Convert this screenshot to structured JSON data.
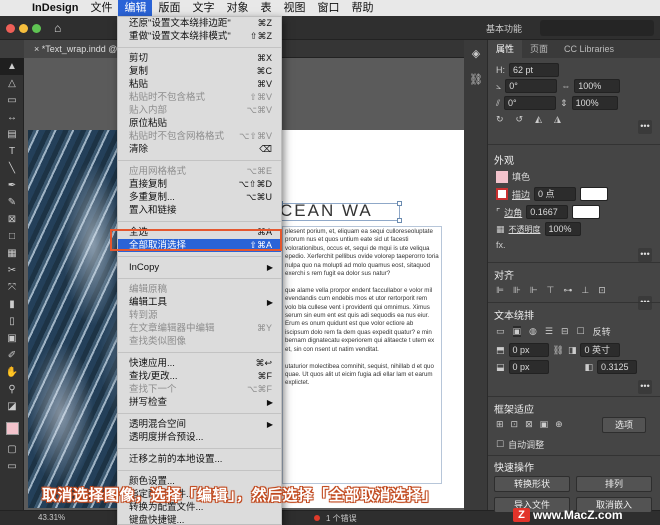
{
  "menubar": {
    "apple_icon": "apple-icon",
    "items": [
      "InDesign",
      "文件",
      "编辑",
      "版面",
      "文字",
      "对象",
      "表",
      "视图",
      "窗口",
      "帮助"
    ]
  },
  "appbar": {
    "workspace": "基本功能"
  },
  "document": {
    "tab": "*Text_wrap.indd @ 50%",
    "heading": "CEAN WA",
    "body": "plesent porium, et, eliquam ea sequi culloreseoluptate prorum nus et quos untium eate sid ut facesti volorationibus, occus et, sequi de mqui is ute veliqua epedio. Xerferchit pellibus ovide volorep taeperorro toria nulpa quo na molupti ad molo quamus eost, sitaquod exerchi s rem fugit ea dolor sus natur?\n\nque alame vella prorpor endent faccullabor e volor mil evendandis cum endebis mos et utor rertorporit rem volo bla cullese vent i providenti qui omnimus. Ximus serum sin eum ent est quis adi sequodis ea nus eiur. Erum es onum quidunt est que volor ectiore ab iscipsum dolo rem fa dem quas expedit quatur? e min bernam dignatecatu experiorem qui alitaecte t utem ex et, sin con nsent ut natim venditat.\n\nutaturior molectibea comnihit, sequist, nihillab d et quo quae. Ut quos alit ut eicim fugia adi ellar lam et earum explictet."
  },
  "statusbar": {
    "zoom": "43.31%",
    "errors": "1 个错误"
  },
  "edit_menu": [
    {
      "label": "还原\"设置文本绕排边距\"",
      "shortcut": "⌘Z",
      "disabled": false
    },
    {
      "label": "重做\"设置文本绕排模式\"",
      "shortcut": "⇧⌘Z",
      "disabled": false
    },
    {
      "sep": true
    },
    {
      "label": "剪切",
      "shortcut": "⌘X",
      "disabled": false
    },
    {
      "label": "复制",
      "shortcut": "⌘C",
      "disabled": false
    },
    {
      "label": "粘贴",
      "shortcut": "⌘V",
      "disabled": false
    },
    {
      "label": "粘贴时不包含格式",
      "shortcut": "⇧⌘V",
      "disabled": true
    },
    {
      "label": "贴入内部",
      "shortcut": "⌥⌘V",
      "disabled": true
    },
    {
      "label": "原位粘贴",
      "shortcut": "",
      "disabled": false
    },
    {
      "label": "粘贴时不包含网格格式",
      "shortcut": "⌥⇧⌘V",
      "disabled": true
    },
    {
      "label": "清除",
      "shortcut": "⌫",
      "disabled": false
    },
    {
      "sep": true
    },
    {
      "label": "应用网格格式",
      "shortcut": "⌥⌘E",
      "disabled": true
    },
    {
      "label": "直接复制",
      "shortcut": "⌥⇧⌘D",
      "disabled": false
    },
    {
      "label": "多重复制...",
      "shortcut": "⌥⌘U",
      "disabled": false
    },
    {
      "label": "置入和链接",
      "shortcut": "",
      "disabled": false
    },
    {
      "sep": true
    },
    {
      "label": "全选",
      "shortcut": "⌘A",
      "disabled": false
    },
    {
      "label": "全部取消选择",
      "shortcut": "⇧⌘A",
      "disabled": false,
      "highlight": true
    },
    {
      "sep": true
    },
    {
      "label": "InCopy",
      "shortcut": "",
      "submenu": true,
      "disabled": false
    },
    {
      "sep": true
    },
    {
      "label": "编辑原稿",
      "shortcut": "",
      "disabled": true
    },
    {
      "label": "编辑工具",
      "shortcut": "",
      "submenu": true,
      "disabled": false
    },
    {
      "label": "转到源",
      "shortcut": "",
      "disabled": true
    },
    {
      "label": "在文章编辑器中编辑",
      "shortcut": "⌘Y",
      "disabled": true
    },
    {
      "label": "查找类似图像",
      "shortcut": "",
      "disabled": true
    },
    {
      "sep": true
    },
    {
      "label": "快速应用...",
      "shortcut": "⌘↩",
      "disabled": false
    },
    {
      "label": "查找/更改...",
      "shortcut": "⌘F",
      "disabled": false
    },
    {
      "label": "查找下一个",
      "shortcut": "⌥⌘F",
      "disabled": true
    },
    {
      "label": "拼写检查",
      "shortcut": "",
      "submenu": true,
      "disabled": false
    },
    {
      "sep": true
    },
    {
      "label": "透明混合空间",
      "shortcut": "",
      "submenu": true,
      "disabled": false
    },
    {
      "label": "透明度拼合预设...",
      "shortcut": "",
      "disabled": false
    },
    {
      "sep": true
    },
    {
      "label": "迁移之前的本地设置...",
      "shortcut": "",
      "disabled": false
    },
    {
      "sep": true
    },
    {
      "label": "颜色设置...",
      "shortcut": "",
      "disabled": false
    },
    {
      "label": "指定配置文件...",
      "shortcut": "",
      "disabled": false
    },
    {
      "label": "转换为配置文件...",
      "shortcut": "",
      "disabled": false
    },
    {
      "label": "键盘快捷键...",
      "shortcut": "",
      "disabled": false
    },
    {
      "label": "菜单...",
      "shortcut": "",
      "disabled": false
    }
  ],
  "panel": {
    "tabs": [
      "属性",
      "页面",
      "CC Libraries"
    ],
    "transform": {
      "angle1": "0°",
      "angle2": "0°",
      "scale1": "100%",
      "scale2": "100%",
      "top_value": "62 pt"
    },
    "appearance": {
      "title": "外观",
      "fill_label": "填色",
      "stroke_label": "描边",
      "stroke_value": "0 点",
      "corner_label": "边角",
      "corner_value": "0.1667",
      "opacity_label": "不透明度",
      "opacity_value": "100%",
      "fx_label": "fx."
    },
    "align": {
      "title": "对齐"
    },
    "text_wrap": {
      "title": "文本绕排",
      "invert_label": "反转",
      "offset_top": "0 px",
      "offset_bottom": "0 px",
      "offset_right": "0 英寸",
      "offset_right2": "0.3125"
    },
    "frame_fit": {
      "title": "框架适应",
      "options_button": "选项",
      "auto_fit_label": "自动调整"
    },
    "quick_actions": {
      "title": "快速操作",
      "convert_shape": "转换形状",
      "arrange": "排列",
      "import_file": "导入文件",
      "cancel_embed": "取消嵌入"
    }
  },
  "caption": "取消选择图像，选择「编辑」，然后选择「全部取消选择」",
  "watermark": {
    "badge": "Z",
    "text": "www.MacZ.com"
  }
}
